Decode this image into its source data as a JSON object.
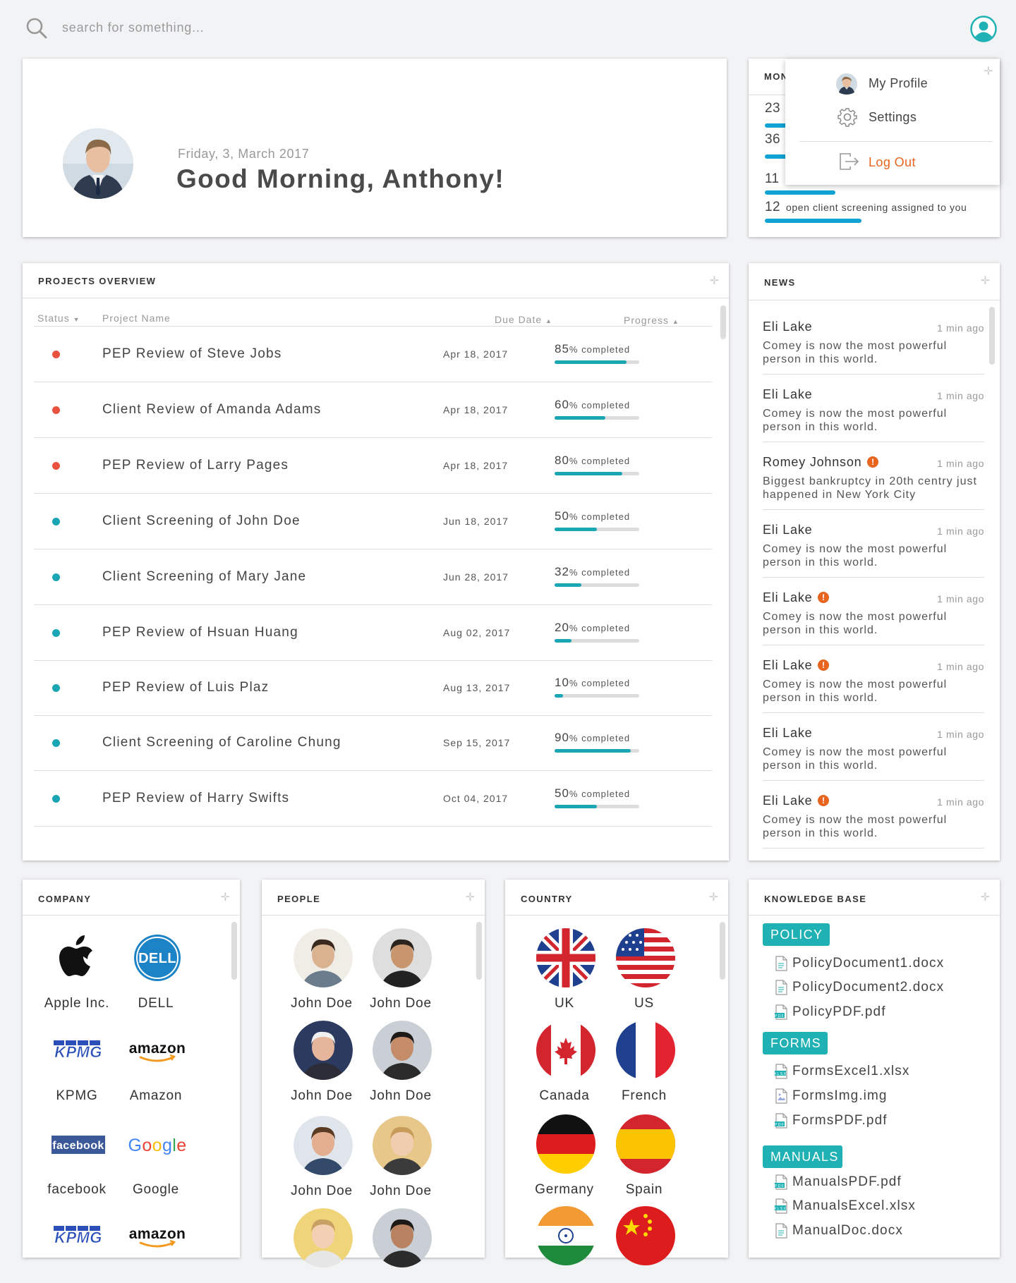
{
  "search": {
    "placeholder": "search for something..."
  },
  "greeting": {
    "date": "Friday, 3, March 2017",
    "message": "Good Morning, Anthony!"
  },
  "monitor": {
    "title": "MON",
    "rows": [
      {
        "value": "23",
        "label": "",
        "bar": 0.22
      },
      {
        "value": "36",
        "label": "",
        "bar": 0.22
      },
      {
        "value": "11",
        "label": "",
        "bar": 0.3
      },
      {
        "value": "12",
        "label": "open client screening assigned to you",
        "bar": 0.42
      }
    ]
  },
  "user_menu": {
    "items": [
      {
        "label": "My Profile",
        "icon": "avatar"
      },
      {
        "label": "Settings",
        "icon": "gear-icon"
      },
      {
        "label": "Log Out",
        "icon": "logout-icon"
      }
    ],
    "logout_color": "#e8651f"
  },
  "projects": {
    "title": "PROJECTS OVERVIEW",
    "columns": {
      "status": "Status",
      "name": "Project Name",
      "due": "Due Date",
      "progress": "Progress"
    },
    "rows": [
      {
        "status": "red",
        "name": "PEP Review of Steve Jobs",
        "due": "Apr 18, 2017",
        "percent": 85,
        "percent_label": "85",
        "suffix": "% completed"
      },
      {
        "status": "red",
        "name": "Client Review of Amanda Adams",
        "due": "Apr 18, 2017",
        "percent": 60,
        "percent_label": "60",
        "suffix": "% completed"
      },
      {
        "status": "red",
        "name": "PEP Review of Larry Pages",
        "due": "Apr 18, 2017",
        "percent": 80,
        "percent_label": "80",
        "suffix": "% completed"
      },
      {
        "status": "teal",
        "name": "Client Screening of John Doe",
        "due": "Jun 18, 2017",
        "percent": 50,
        "percent_label": "50",
        "suffix": "% completed"
      },
      {
        "status": "teal",
        "name": "Client Screening of Mary Jane",
        "due": "Jun 28, 2017",
        "percent": 32,
        "percent_label": "32",
        "suffix": "% completed"
      },
      {
        "status": "teal",
        "name": "PEP Review of Hsuan Huang",
        "due": "Aug 02, 2017",
        "percent": 20,
        "percent_label": "20",
        "suffix": "% completed"
      },
      {
        "status": "teal",
        "name": "PEP Review of Luis Plaz",
        "due": "Aug 13, 2017",
        "percent": 10,
        "percent_label": "10",
        "suffix": "% completed"
      },
      {
        "status": "teal",
        "name": "Client Screening of Caroline Chung",
        "due": "Sep 15, 2017",
        "percent": 90,
        "percent_label": "90",
        "suffix": "% completed"
      },
      {
        "status": "teal",
        "name": "PEP Review of Harry Swifts",
        "due": "Oct 04, 2017",
        "percent": 50,
        "percent_label": "50",
        "suffix": "% completed"
      }
    ],
    "status_colors": {
      "red": "#e9523f",
      "teal": "#1aa6b3"
    }
  },
  "news": {
    "title": "NEWS",
    "items": [
      {
        "author": "Eli Lake",
        "alert": false,
        "time": "1 min ago",
        "text": "Comey is now the most powerful person in this world."
      },
      {
        "author": "Eli Lake",
        "alert": false,
        "time": "1 min ago",
        "text": "Comey is now the most powerful person in this world."
      },
      {
        "author": "Romey Johnson",
        "alert": true,
        "time": "1 min ago",
        "text": "Biggest bankruptcy in 20th centry just happened in New York City"
      },
      {
        "author": "Eli Lake",
        "alert": false,
        "time": "1 min ago",
        "text": "Comey is now the most powerful person in this world."
      },
      {
        "author": "Eli Lake",
        "alert": true,
        "time": "1 min ago",
        "text": "Comey is now the most powerful person in this world."
      },
      {
        "author": "Eli Lake",
        "alert": true,
        "time": "1 min ago",
        "text": "Comey is now the most powerful person in this world."
      },
      {
        "author": "Eli Lake",
        "alert": false,
        "time": "1 min ago",
        "text": "Comey is now the most powerful person in this world."
      },
      {
        "author": "Eli Lake",
        "alert": true,
        "time": "1 min ago",
        "text": "Comey is now the most powerful person in this world."
      }
    ]
  },
  "company": {
    "title": "COMPANY",
    "items": [
      {
        "label": "Apple Inc.",
        "logo": "apple-logo"
      },
      {
        "label": "DELL",
        "logo": "dell-logo",
        "logo_text": "DELL"
      },
      {
        "label": "KPMG",
        "logo": "kpmg-logo",
        "logo_text": "KPMG"
      },
      {
        "label": "Amazon",
        "logo": "amazon-logo",
        "logo_text": "amazon"
      },
      {
        "label": "facebook",
        "logo": "facebook-logo",
        "logo_text": "facebook"
      },
      {
        "label": "Google",
        "logo": "google-logo",
        "logo_text": "Google"
      },
      {
        "label": "",
        "logo": "kpmg-logo",
        "logo_text": "KPMG"
      },
      {
        "label": "",
        "logo": "amazon-logo",
        "logo_text": "amazon"
      }
    ]
  },
  "people": {
    "title": "PEOPLE",
    "items": [
      {
        "label": "John Doe"
      },
      {
        "label": "John Doe"
      },
      {
        "label": "John Doe"
      },
      {
        "label": "John Doe"
      },
      {
        "label": "John Doe"
      },
      {
        "label": "John Doe"
      },
      {
        "label": ""
      },
      {
        "label": ""
      }
    ]
  },
  "country": {
    "title": "COUNTRY",
    "items": [
      {
        "label": "UK",
        "flag": "uk-flag-icon"
      },
      {
        "label": "US",
        "flag": "us-flag-icon"
      },
      {
        "label": "Canada",
        "flag": "canada-flag-icon"
      },
      {
        "label": "French",
        "flag": "france-flag-icon"
      },
      {
        "label": "Germany",
        "flag": "germany-flag-icon"
      },
      {
        "label": "Spain",
        "flag": "spain-flag-icon"
      },
      {
        "label": "",
        "flag": "india-flag-icon"
      },
      {
        "label": "",
        "flag": "china-flag-icon"
      }
    ]
  },
  "knowledge": {
    "title": "KNOWLEDGE BASE",
    "groups": [
      {
        "tag": "POLICY",
        "files": [
          {
            "name": "PolicyDocument1.docx",
            "type": "doc"
          },
          {
            "name": "PolicyDocument2.docx",
            "type": "doc"
          },
          {
            "name": "PolicyPDF.pdf",
            "type": "pdf"
          }
        ]
      },
      {
        "tag": "FORMS",
        "files": [
          {
            "name": "FormsExcel1.xlsx",
            "type": "xlsx"
          },
          {
            "name": "FormsImg.img",
            "type": "img"
          },
          {
            "name": "FormsPDF.pdf",
            "type": "pdf"
          }
        ]
      },
      {
        "tag": "MANUALS",
        "files": [
          {
            "name": "ManualsPDF.pdf",
            "type": "pdf"
          },
          {
            "name": "ManualsExcel.xlsx",
            "type": "xlsx"
          },
          {
            "name": "ManualDoc.docx",
            "type": "doc"
          }
        ]
      }
    ]
  }
}
